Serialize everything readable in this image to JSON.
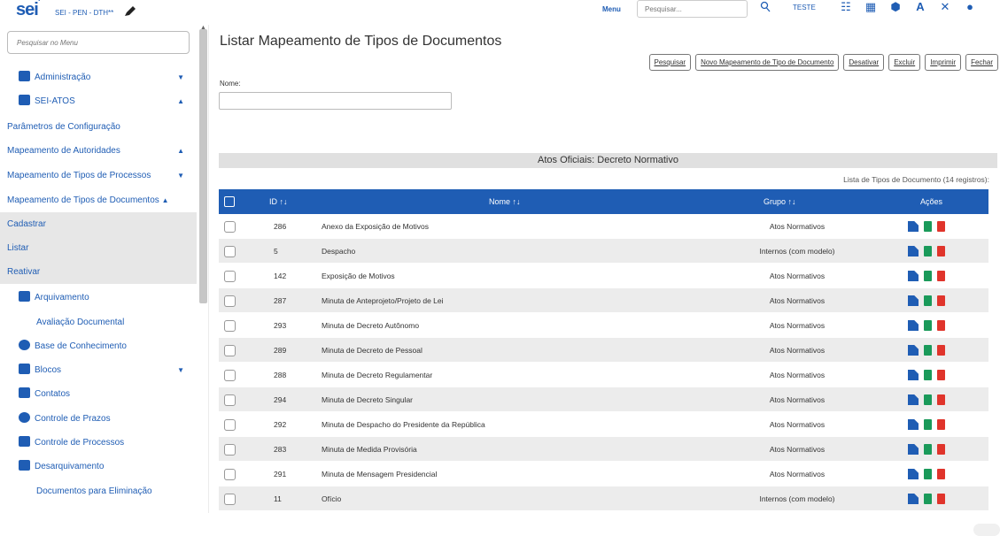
{
  "topbar": {
    "logo": "sei",
    "org": "SEI - PEN - DTH**",
    "menu_label": "Menu",
    "search_placeholder": "Pesquisar...",
    "unit": "TESTE"
  },
  "sidebar": {
    "search_placeholder": "Pesquisar no Menu",
    "items": [
      {
        "label": "Administração",
        "icon": "gears-icon",
        "chevron": "▼"
      },
      {
        "label": "SEI-ATOS",
        "icon": "folder-icon",
        "chevron": "▲"
      },
      {
        "label": "Parâmetros de Configuração"
      },
      {
        "label": "Mapeamento de Autoridades",
        "chevron": "▲"
      },
      {
        "label": "Mapeamento de Tipos de Processos",
        "chevron": "▼"
      },
      {
        "label": "Mapeamento de Tipos de Documentos",
        "chevron": "▲"
      },
      {
        "label": "Cadastrar"
      },
      {
        "label": "Listar"
      },
      {
        "label": "Reativar"
      },
      {
        "label": "Arquivamento",
        "icon": "archive-icon"
      },
      {
        "label": "Avaliação Documental"
      },
      {
        "label": "Base de Conhecimento",
        "icon": "database-icon"
      },
      {
        "label": "Blocos",
        "icon": "blocks-icon",
        "chevron": "▼"
      },
      {
        "label": "Contatos",
        "icon": "contacts-icon"
      },
      {
        "label": "Controle de Prazos",
        "icon": "clock-icon"
      },
      {
        "label": "Controle de Processos",
        "icon": "list-icon"
      },
      {
        "label": "Desarquivamento",
        "icon": "unarchive-icon"
      },
      {
        "label": "Documentos para Eliminação"
      }
    ]
  },
  "main": {
    "title": "Listar Mapeamento de Tipos de Documentos",
    "buttons": [
      "Pesquisar",
      "Novo Mapeamento de Tipo de Documento",
      "Desativar",
      "Excluir",
      "Imprimir",
      "Fechar"
    ],
    "nome_label": "Nome:",
    "section_title": "Atos Oficiais: Decreto Normativo",
    "records_caption": "Lista de Tipos de Documento (14 registros):",
    "table": {
      "headers": {
        "id": "ID",
        "nome": "Nome",
        "grupo": "Grupo",
        "acoes": "Ações"
      },
      "rows": [
        {
          "id": "286",
          "nome": "Anexo da Exposição de Motivos",
          "grupo": "Atos Normativos"
        },
        {
          "id": "5",
          "nome": "Despacho",
          "grupo": "Internos (com modelo)"
        },
        {
          "id": "142",
          "nome": "Exposição de Motivos",
          "grupo": "Atos Normativos"
        },
        {
          "id": "287",
          "nome": "Minuta de Anteprojeto/Projeto de Lei",
          "grupo": "Atos Normativos"
        },
        {
          "id": "293",
          "nome": "Minuta de Decreto Autônomo",
          "grupo": "Atos Normativos"
        },
        {
          "id": "289",
          "nome": "Minuta de Decreto de Pessoal",
          "grupo": "Atos Normativos"
        },
        {
          "id": "288",
          "nome": "Minuta de Decreto Regulamentar",
          "grupo": "Atos Normativos"
        },
        {
          "id": "294",
          "nome": "Minuta de Decreto Singular",
          "grupo": "Atos Normativos"
        },
        {
          "id": "292",
          "nome": "Minuta de Despacho do Presidente da República",
          "grupo": "Atos Normativos"
        },
        {
          "id": "283",
          "nome": "Minuta de Medida Provisória",
          "grupo": "Atos Normativos"
        },
        {
          "id": "291",
          "nome": "Minuta de Mensagem Presidencial",
          "grupo": "Atos Normativos"
        },
        {
          "id": "11",
          "nome": "Ofício",
          "grupo": "Internos (com modelo)"
        }
      ]
    }
  },
  "colors": {
    "primary": "#1f5db4",
    "header_bg": "#1f5db4",
    "row_alt": "#ececec",
    "delete": "#e0342b",
    "other": "#1a9a5a"
  }
}
